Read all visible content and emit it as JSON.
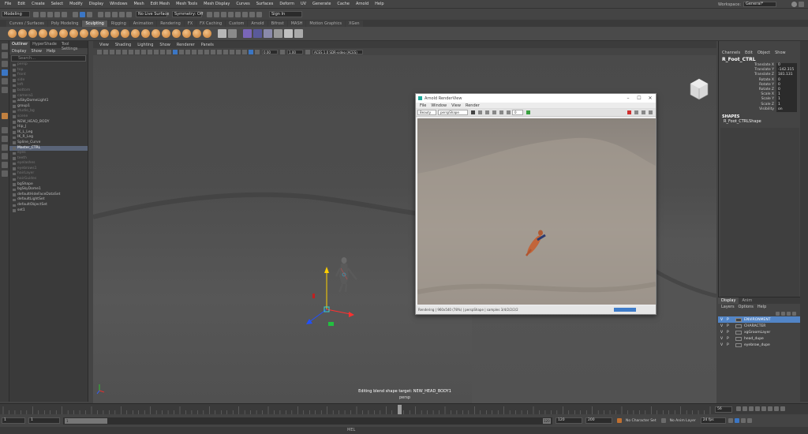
{
  "menubar": {
    "items": [
      "File",
      "Edit",
      "Create",
      "Select",
      "Modify",
      "Display",
      "Windows",
      "Mesh",
      "Edit Mesh",
      "Mesh Tools",
      "Mesh Display",
      "Curves",
      "Surfaces",
      "Deform",
      "UV",
      "Generate",
      "Cache",
      "Arnold",
      "Help"
    ],
    "workspace_label": "Workspace:",
    "workspace_value": "General*"
  },
  "statusline": {
    "mode": "Modeling",
    "live_surface": "No Live Surface",
    "symmetry": "Symmetry: Off",
    "signin": "Sign In"
  },
  "shelf_tabs": [
    "Curves / Surfaces",
    "Poly Modeling",
    "Sculpting",
    "Rigging",
    "Animation",
    "Rendering",
    "FX",
    "FX Caching",
    "Custom",
    "Arnold",
    "Bifrost",
    "MASH",
    "Motion Graphics",
    "XGen"
  ],
  "shelf_active": "Sculpting",
  "outliner": {
    "tabs": [
      "Outliner",
      "HyperShade",
      "Tool Settings"
    ],
    "menus": [
      "Display",
      "Show",
      "Help"
    ],
    "search_placeholder": "Search...",
    "items": [
      {
        "label": "persp",
        "dim": true
      },
      {
        "label": "top",
        "dim": true
      },
      {
        "label": "front",
        "dim": true
      },
      {
        "label": "side",
        "dim": true
      },
      {
        "label": "left",
        "dim": true
      },
      {
        "label": "bottom",
        "dim": true
      },
      {
        "label": "camera1",
        "dim": true
      },
      {
        "label": "aiSkyDomeLight1",
        "dim": false
      },
      {
        "label": "group1",
        "dim": false
      },
      {
        "label": "studio_bg",
        "dim": true
      },
      {
        "label": "scene",
        "dim": true
      },
      {
        "label": "NEW_HEAD_BODY",
        "dim": false
      },
      {
        "label": "Hip_J",
        "dim": false
      },
      {
        "label": "IK_L_Leg",
        "dim": false
      },
      {
        "label": "IK_R_Leg",
        "dim": false
      },
      {
        "label": "Spline_Curve",
        "dim": false
      },
      {
        "label": "Master_CTRL",
        "dim": false,
        "selected": true
      },
      {
        "label": "eyes",
        "dim": true
      },
      {
        "label": "teeth",
        "dim": true
      },
      {
        "label": "eyelashes",
        "dim": true
      },
      {
        "label": "eyebrows1",
        "dim": true
      },
      {
        "label": "hairLayer",
        "dim": true
      },
      {
        "label": "hairGuides",
        "dim": true
      },
      {
        "label": "bgShape",
        "dim": false
      },
      {
        "label": "bgSkyDome1",
        "dim": false
      },
      {
        "label": "defaultHideFaceDataSet",
        "dim": false
      },
      {
        "label": "defaultLightSet",
        "dim": false
      },
      {
        "label": "defaultObjectSet",
        "dim": false
      },
      {
        "label": "set1",
        "dim": false
      }
    ]
  },
  "viewport": {
    "menus": [
      "View",
      "Shading",
      "Lighting",
      "Show",
      "Renderer",
      "Panels"
    ],
    "near": "0.00",
    "far": "1.00",
    "colorspace": "ACES 1.0 SDR-video (ACES)",
    "hud": "Editing blend shape target: NEW_HEAD_BODY1",
    "camera": "persp"
  },
  "render_view": {
    "title": "Arnold RenderView",
    "menus": [
      "File",
      "Window",
      "View",
      "Render"
    ],
    "beauty": "Beauty",
    "camera": "perspShape",
    "value": "0",
    "status": "Rendering | 960x540 (78%) | perspShape | samples 3/4/2/2/2/2"
  },
  "channel_box": {
    "menus": [
      "Channels",
      "Edit",
      "Object",
      "Show"
    ],
    "object": "R_Foot_CTRL",
    "attrs": [
      {
        "name": "Translate X",
        "value": "0"
      },
      {
        "name": "Translate Y",
        "value": "-142.315"
      },
      {
        "name": "Translate Z",
        "value": "181.131"
      },
      {
        "name": "Rotate X",
        "value": "0"
      },
      {
        "name": "Rotate Y",
        "value": "0"
      },
      {
        "name": "Rotate Z",
        "value": "0"
      },
      {
        "name": "Scale X",
        "value": "1"
      },
      {
        "name": "Scale Y",
        "value": "1"
      },
      {
        "name": "Scale Z",
        "value": "1"
      },
      {
        "name": "Visibility",
        "value": "on"
      }
    ],
    "shapes_label": "SHAPES",
    "shape": "R_Foot_CTRLShape"
  },
  "layers": {
    "tabs": [
      "Display",
      "Anim"
    ],
    "menus": [
      "Layers",
      "Options",
      "Help"
    ],
    "rows": [
      {
        "v": "V",
        "p": "P",
        "name": "ENVIRONMENT",
        "selected": true
      },
      {
        "v": "V",
        "p": "P",
        "name": "CHARACTER",
        "selected": false
      },
      {
        "v": "V",
        "p": "P",
        "name": "xgGroomLayer",
        "selected": false
      },
      {
        "v": "V",
        "p": "P",
        "name": "head_dupe",
        "selected": false
      },
      {
        "v": "V",
        "p": "P",
        "name": "eyebrow_dupe",
        "selected": false
      }
    ]
  },
  "range": {
    "start": "1",
    "start2": "1",
    "range_start": "1",
    "range_end": "120",
    "end": "120",
    "end2": "200",
    "current": "56",
    "fps": "24 fps",
    "char_set": "No Character Set",
    "anim_layer": "No Anim Layer"
  },
  "cmdline": {
    "label": "MEL"
  }
}
